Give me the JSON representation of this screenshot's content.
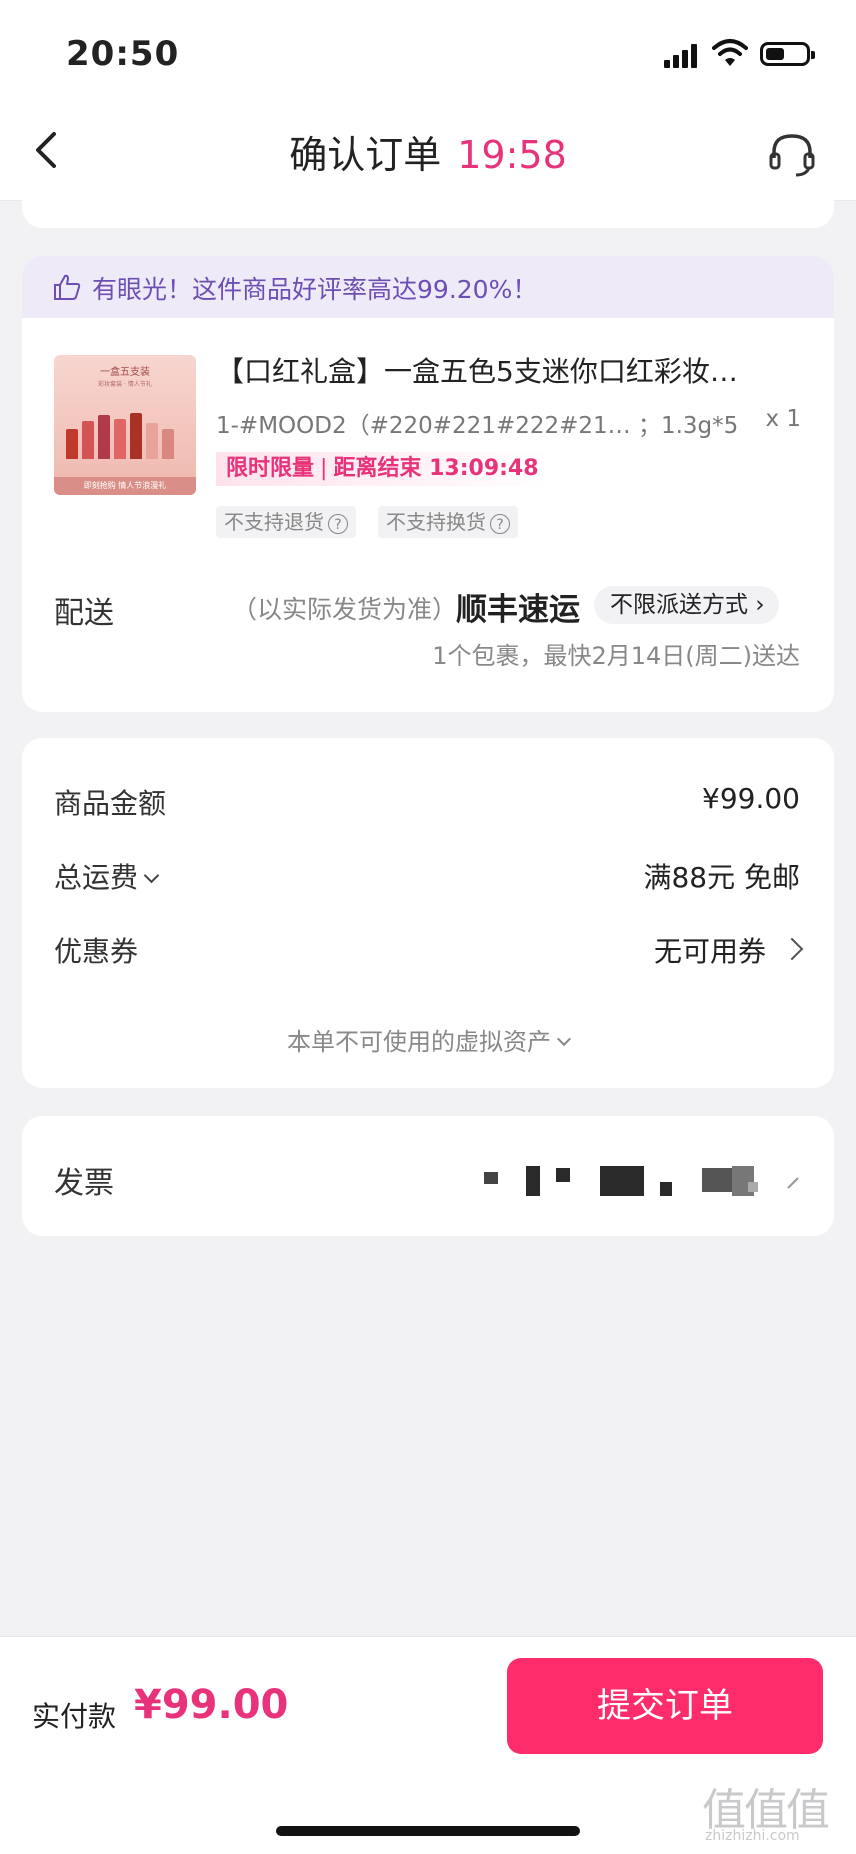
{
  "status_bar": {
    "time": "20:50"
  },
  "nav": {
    "title": "确认订单",
    "timer": "19:58"
  },
  "banner": {
    "icon": "thumbs-up-icon",
    "text": "有眼光！这件商品好评率高达99.20%！"
  },
  "product": {
    "image_title": "一盒五支装",
    "image_subtitle": "彩妆套装 · 情人节礼",
    "image_footer": "即刻抢购  情人节浪漫礼",
    "title": "【口红礼盒】一盒五色5支迷你口红彩妆…",
    "spec": "1-#MOOD2（#220#221#222#21… ；1.3g*5",
    "quantity": "x 1",
    "flash_label": "限时限量",
    "flash_divider": "|",
    "flash_countdown_label": "距离结束",
    "flash_countdown": "13:09:48",
    "tags": [
      "不支持退货",
      "不支持换货"
    ],
    "tag_help": "?"
  },
  "shipping": {
    "label": "配送",
    "note": "（以实际发货为准）",
    "carrier": "顺丰速运",
    "mode": "不限派送方式",
    "mode_arrow": "›",
    "eta": "1个包裹，最快2月14日(周二)送达"
  },
  "summary": {
    "goods_label": "商品金额",
    "goods_value": "¥99.00",
    "freight_label": "总运费",
    "freight_value": "满88元 免邮",
    "coupon_label": "优惠券",
    "coupon_value": "无可用券",
    "virtual_assets": "本单不可使用的虚拟资产"
  },
  "invoice": {
    "label": "发票"
  },
  "footer": {
    "pay_label": "实付款",
    "pay_amount": "¥99.00",
    "submit": "提交订单"
  },
  "watermark": {
    "main": "值值值",
    "sub": "zhizhizhi.com"
  },
  "colors": {
    "accent": "#e8327a",
    "button": "#fe2c6a",
    "banner_bg": "#efeaf8",
    "banner_text": "#6c4fb3",
    "page_bg": "#f2f2f4"
  }
}
